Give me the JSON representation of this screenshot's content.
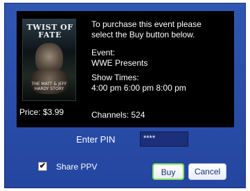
{
  "event_poster": {
    "title": "TWIST OF FATE",
    "subtitle": "THE MATT & JEFF HARDY STORY"
  },
  "price": "Price: $3.99",
  "info": {
    "instruction_line1": "To purchase this event please",
    "instruction_line2": "select the Buy button below.",
    "event_label": "Event:",
    "event_value": "WWE Presents",
    "showtimes_label": "Show Times:",
    "showtimes_value": "4:00 pm 6:00 pm 8:00 pm",
    "channels": "Channels:  524"
  },
  "pin": {
    "label": "Enter PIN",
    "value": "****"
  },
  "share": {
    "label": "Share PPV",
    "checked_mark": "✔"
  },
  "buttons": {
    "buy": "Buy",
    "cancel": "Cancel"
  },
  "colors": {
    "dialog_bg": "#2a4faa",
    "focus_border": "#7fe05a",
    "button_text": "#1a2f78"
  }
}
